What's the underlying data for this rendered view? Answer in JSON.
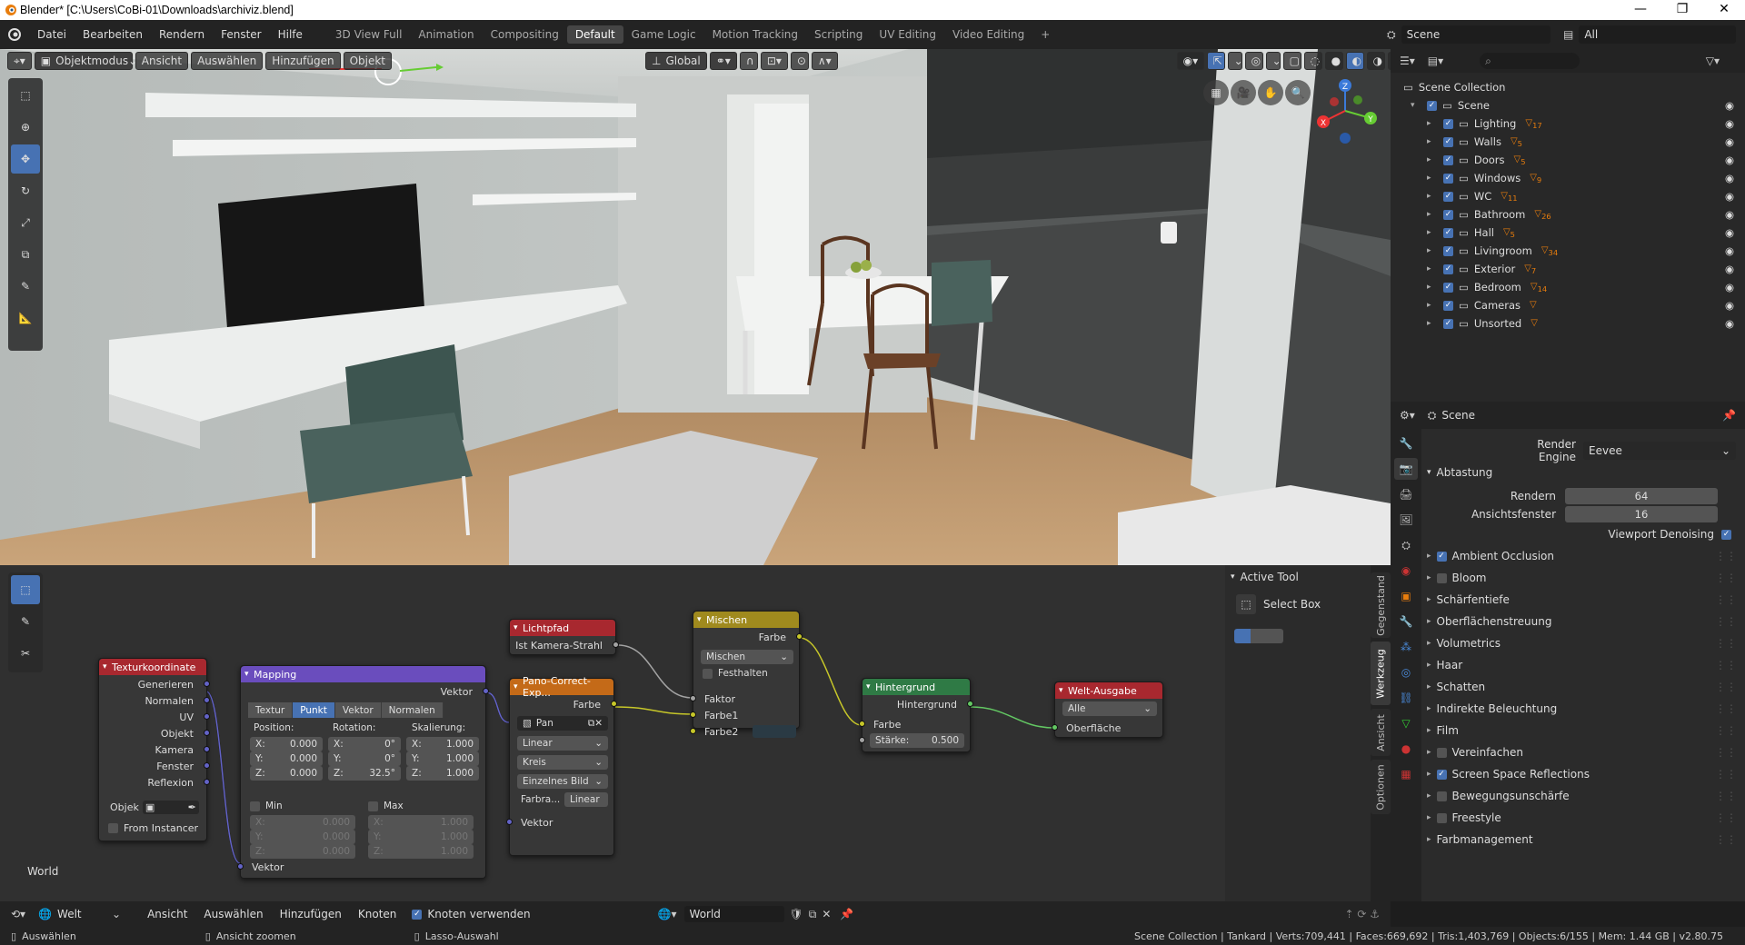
{
  "window": {
    "title": "Blender* [C:\\Users\\CoBi-01\\Downloads\\archiviz.blend]",
    "minimize": "—",
    "maximize": "❐",
    "close": "✕"
  },
  "menubar": {
    "menus": [
      "Datei",
      "Bearbeiten",
      "Rendern",
      "Fenster",
      "Hilfe"
    ],
    "workspaces": [
      "3D View Full",
      "Animation",
      "Compositing",
      "Default",
      "Game Logic",
      "Motion Tracking",
      "Scripting",
      "UV Editing",
      "Video Editing"
    ],
    "active_workspace": "Default",
    "add": "+",
    "scene_name": "Scene",
    "viewlayer_name": "All"
  },
  "viewport": {
    "mode": "Objektmodus",
    "menus": [
      "Ansicht",
      "Auswählen",
      "Hinzufügen",
      "Objekt"
    ],
    "orientation": "Global",
    "gizmo_axes": [
      "X",
      "Y",
      "Z"
    ]
  },
  "outliner": {
    "root": "Scene Collection",
    "scene": "Scene",
    "collections": [
      {
        "name": "Lighting",
        "badge": "17"
      },
      {
        "name": "Walls",
        "badge": "5"
      },
      {
        "name": "Doors",
        "badge": "5"
      },
      {
        "name": "Windows",
        "badge": "9"
      },
      {
        "name": "WC",
        "badge": "11"
      },
      {
        "name": "Bathroom",
        "badge": "26"
      },
      {
        "name": "Hall",
        "badge": "5"
      },
      {
        "name": "Livingroom",
        "badge": "34"
      },
      {
        "name": "Exterior",
        "badge": "7"
      },
      {
        "name": "Bedroom",
        "badge": "14"
      },
      {
        "name": "Cameras",
        "badge": ""
      },
      {
        "name": "Unsorted",
        "badge": ""
      }
    ]
  },
  "properties": {
    "context": "Scene",
    "render_engine_label": "Render Engine",
    "render_engine": "Eevee",
    "sampling": {
      "title": "Abtastung",
      "render_label": "Rendern",
      "render_value": "64",
      "viewport_label": "Ansichtsfenster",
      "viewport_value": "16",
      "denoise_label": "Viewport Denoising"
    },
    "panels": [
      {
        "label": "Ambient Occlusion",
        "checkbox": true,
        "checked": true
      },
      {
        "label": "Bloom",
        "checkbox": true,
        "checked": false
      },
      {
        "label": "Schärfentiefe",
        "checkbox": false
      },
      {
        "label": "Oberflächenstreuung",
        "checkbox": false
      },
      {
        "label": "Volumetrics",
        "checkbox": false
      },
      {
        "label": "Haar",
        "checkbox": false
      },
      {
        "label": "Schatten",
        "checkbox": false
      },
      {
        "label": "Indirekte Beleuchtung",
        "checkbox": false
      },
      {
        "label": "Film",
        "checkbox": false
      },
      {
        "label": "Vereinfachen",
        "checkbox": true,
        "checked": false
      },
      {
        "label": "Screen Space Reflections",
        "checkbox": true,
        "checked": true
      },
      {
        "label": "Bewegungsunschärfe",
        "checkbox": true,
        "checked": false
      },
      {
        "label": "Freestyle",
        "checkbox": true,
        "checked": false
      },
      {
        "label": "Farbmanagement",
        "checkbox": false
      }
    ]
  },
  "node_editor": {
    "context_label": "World",
    "nodes": {
      "texcoord": {
        "title": "Texturkoordinate",
        "outputs": [
          "Generieren",
          "Normalen",
          "UV",
          "Objekt",
          "Kamera",
          "Fenster",
          "Reflexion"
        ],
        "object_label": "Objek",
        "from_instancer": "From Instancer"
      },
      "mapping": {
        "title": "Mapping",
        "output": "Vektor",
        "tabs": [
          "Textur",
          "Punkt",
          "Vektor",
          "Normalen"
        ],
        "active_tab": "Punkt",
        "position_label": "Position:",
        "rotation_label": "Rotation:",
        "scale_label": "Skalierung:",
        "position": [
          "X:",
          "0.000",
          "Y:",
          "0.000",
          "Z:",
          "0.000"
        ],
        "rotation": [
          "X:",
          "0°",
          "Y:",
          "0°",
          "Z:",
          "32.5°"
        ],
        "scale": [
          "X:",
          "1.000",
          "Y:",
          "1.000",
          "Z:",
          "1.000"
        ],
        "min_label": "Min",
        "max_label": "Max",
        "min": [
          "X:",
          "0.000",
          "Y:",
          "0.000",
          "Z:",
          "0.000"
        ],
        "max": [
          "X:",
          "1.000",
          "Y:",
          "1.000",
          "Z:",
          "1.000"
        ],
        "input": "Vektor"
      },
      "lightpath": {
        "title": "Lichtpfad",
        "output": "Ist Kamera-Strahl"
      },
      "envtex": {
        "title": "Pano-Correct-Exp...",
        "output": "Farbe",
        "image": "Pan",
        "interp": "Linear",
        "proj": "Kreis",
        "source": "Einzelnes Bild",
        "color_label": "Farbra...",
        "color_value": "Linear",
        "input": "Vektor"
      },
      "mix": {
        "title": "Mischen",
        "output": "Farbe",
        "blend": "Mischen",
        "clamp": "Festhalten",
        "inputs": [
          "Faktor",
          "Farbe1",
          "Farbe2"
        ]
      },
      "background": {
        "title": "Hintergrund",
        "output": "Hintergrund",
        "color": "Farbe",
        "strength_label": "Stärke:",
        "strength": "0.500"
      },
      "output": {
        "title": "Welt-Ausgabe",
        "target": "Alle",
        "input": "Oberfläche"
      }
    }
  },
  "active_tool": {
    "title": "Active Tool",
    "tool": "Select Box"
  },
  "side_tabs": [
    "Gegenstand",
    "Werkzeug",
    "Ansicht",
    "Optionen"
  ],
  "node_footer": {
    "editor": "Welt",
    "menus": [
      "Ansicht",
      "Auswählen",
      "Hinzufügen",
      "Knoten"
    ],
    "use_nodes": "Knoten verwenden",
    "world": "World"
  },
  "status": {
    "left": [
      "Auswählen",
      "Ansicht zoomen",
      "Lasso-Auswahl"
    ],
    "right": "Scene Collection | Tankard | Verts:709,441 | Faces:669,692 | Tris:1,403,769 | Objects:6/155 | Mem: 1.44 GB | v2.80.75"
  },
  "colors": {
    "accent": "#4772b3",
    "header_bg": "#232323",
    "node_green": "#2f7a45",
    "node_red": "#a8282f",
    "node_purple": "#6a4dbd",
    "node_yellow": "#a08a1e",
    "node_orange": "#c46a18"
  }
}
